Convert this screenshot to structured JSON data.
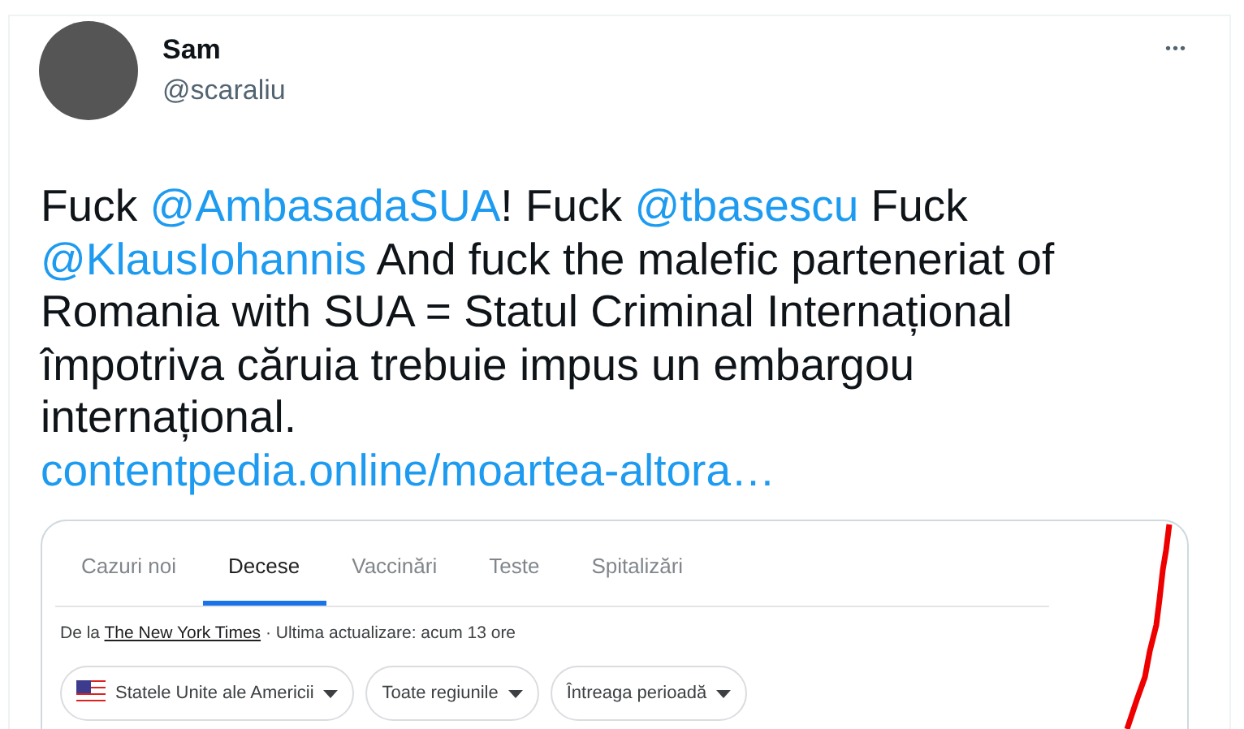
{
  "tweet": {
    "name": "Sam",
    "handle": "@scaraliu",
    "more": "•••",
    "lines": [
      [
        {
          "kind": "text",
          "text": "Fuck "
        },
        {
          "kind": "mention",
          "text": "@AmbasadaSUA"
        },
        {
          "kind": "text",
          "text": "! Fuck "
        },
        {
          "kind": "mention",
          "text": "@tbasescu"
        },
        {
          "kind": "text",
          "text": " Fuck"
        }
      ],
      [
        {
          "kind": "mention",
          "text": "@KlausIohannis"
        },
        {
          "kind": "text",
          "text": " And fuck the malefic parteneriat of"
        }
      ],
      [
        {
          "kind": "text",
          "text": "Romania with SUA = Statul Criminal Internațional"
        }
      ],
      [
        {
          "kind": "text",
          "text": "împotriva căruia trebuie impus un embargou"
        }
      ],
      [
        {
          "kind": "text",
          "text": "internațional."
        }
      ],
      [
        {
          "kind": "link",
          "text": "contentpedia.online/moartea-altora…"
        }
      ]
    ]
  },
  "embed": {
    "tabs": [
      {
        "label": "Cazuri noi",
        "selected": false
      },
      {
        "label": "Decese",
        "selected": true
      },
      {
        "label": "Vaccinări",
        "selected": false
      },
      {
        "label": "Teste",
        "selected": false
      },
      {
        "label": "Spitalizări",
        "selected": false
      }
    ],
    "source_prefix": "De la",
    "source_link": "The New York Times",
    "source_suffix": " · Ultima actualizare: acum 13 ore",
    "filters": [
      {
        "kind": "flag",
        "label": "Statele Unite ale Americii"
      },
      {
        "kind": "plain",
        "label": "Toate regiunile"
      },
      {
        "kind": "plain",
        "label": "Întreaga perioadă"
      }
    ]
  }
}
